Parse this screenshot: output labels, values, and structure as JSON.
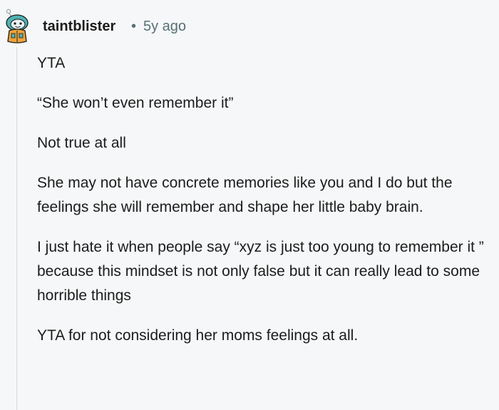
{
  "comment": {
    "author": "taintblister",
    "separator": "•",
    "age": "5y ago",
    "avatar_icon": "snoo-avatar-icon",
    "paragraphs": [
      "YTA",
      "“She won’t even remember it”",
      "Not true at all",
      "She may not have concrete memories like you and I do but the feelings she will remember and shape her little baby brain.",
      "I just hate it when people say “xyz is just too young to remember it ” because this mindset is not only false but it can really lead to some horrible things",
      "YTA for not considering her moms feelings at all."
    ]
  },
  "colors": {
    "background": "#f6f7f8",
    "text": "#1c1c1c",
    "meta": "#576f76",
    "thread_line": "#d6d9dc",
    "avatar_teal": "#4fb3b3",
    "avatar_orange": "#f0a33a"
  }
}
